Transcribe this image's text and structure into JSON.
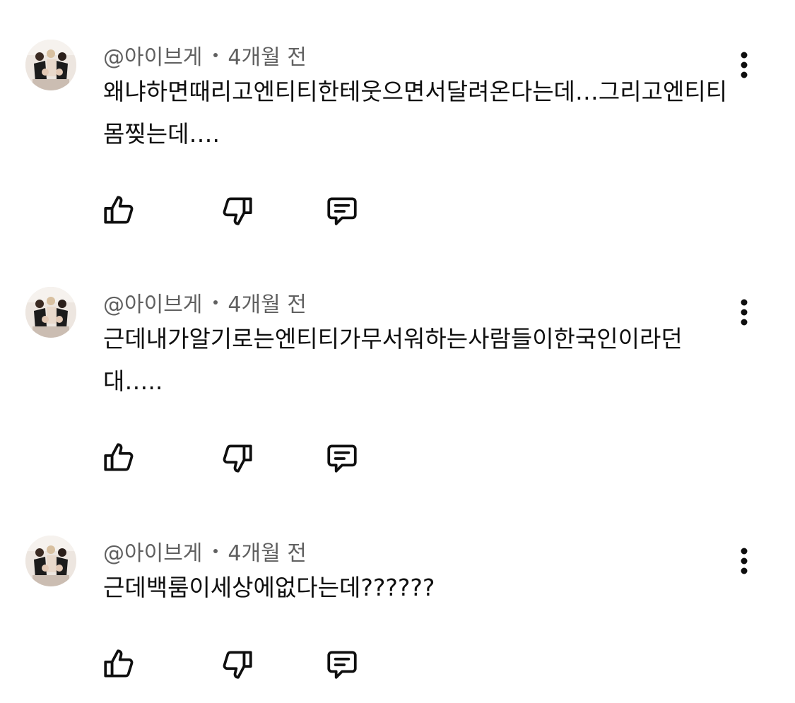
{
  "comments": [
    {
      "author": "@아이브게",
      "time": "4개월 전",
      "text": "왜냐하면때리고엔티티한테웃으면서달려온다는데…그리고엔티티몸찢는데….",
      "icons": {
        "avatar": "channel-avatar",
        "menu": "more-vert-icon",
        "like": "thumb-up-icon",
        "dislike": "thumb-down-icon",
        "reply": "reply-comment-icon"
      }
    },
    {
      "author": "@아이브게",
      "time": "4개월 전",
      "text": "근데내가알기로는엔티티가무서워하는사람들이한국인이라던대…..",
      "icons": {
        "avatar": "channel-avatar",
        "menu": "more-vert-icon",
        "like": "thumb-up-icon",
        "dislike": "thumb-down-icon",
        "reply": "reply-comment-icon"
      }
    },
    {
      "author": "@아이브게",
      "time": "4개월 전",
      "text": "근데백룸이세상에없다는데??????",
      "icons": {
        "avatar": "channel-avatar",
        "menu": "more-vert-icon",
        "like": "thumb-up-icon",
        "dislike": "thumb-down-icon",
        "reply": "reply-comment-icon"
      }
    }
  ],
  "colors": {
    "text": "#0f0f0f",
    "meta": "#606060",
    "background": "#ffffff"
  }
}
